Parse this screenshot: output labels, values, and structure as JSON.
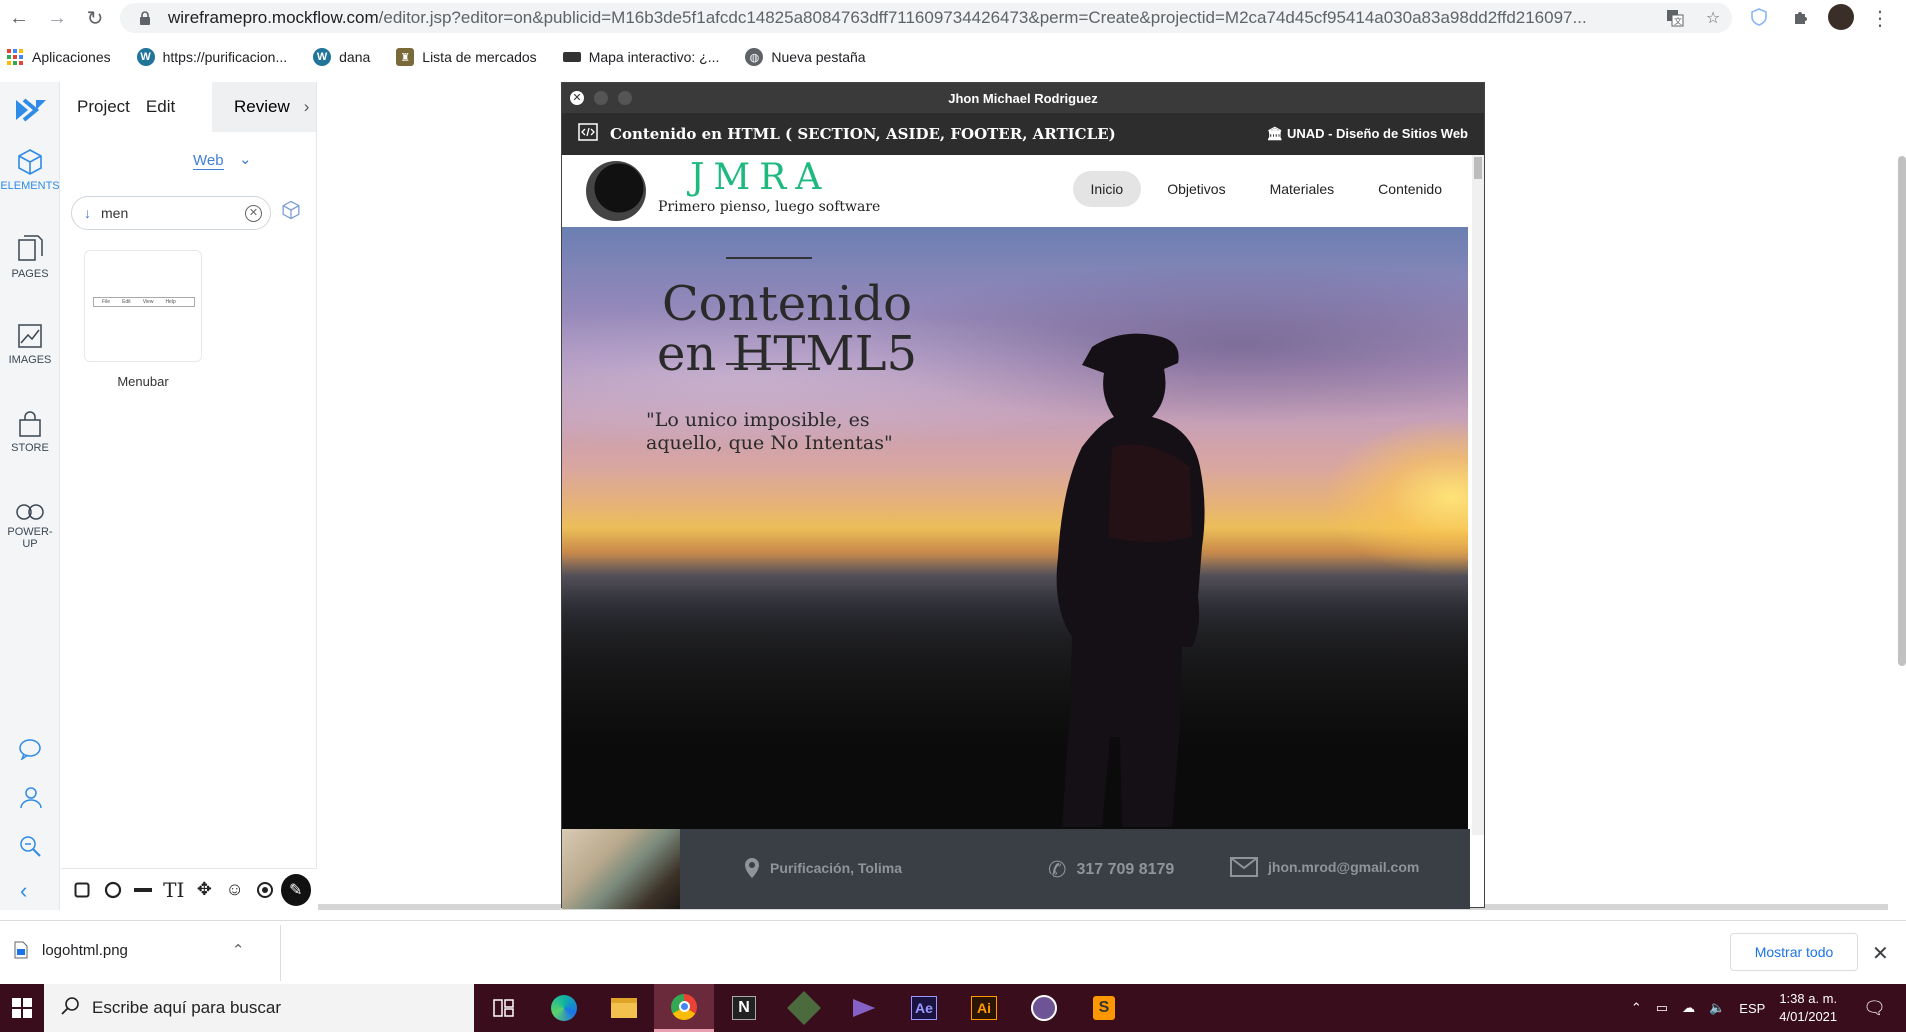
{
  "browser": {
    "url_host": "wireframepro.mockflow.com",
    "url_rest": "/editor.jsp?editor=on&publicid=M16b3de5f1afcdc14825a8084763dff711609734426473&perm=Create&projectid=M2ca74d45cf95414a030a83a98dd2ffd216097...",
    "bookmarks": [
      {
        "label": "Aplicaciones",
        "icon": "apps-grid-icon",
        "color": "#e34234"
      },
      {
        "label": "https://purificacion...",
        "icon": "wordpress-icon",
        "color": "#21759b"
      },
      {
        "label": "dana",
        "icon": "wordpress-icon",
        "color": "#21759b"
      },
      {
        "label": "Lista de mercados",
        "icon": "shield-crest-icon",
        "color": "#7a6a3a"
      },
      {
        "label": "Mapa interactivo: ¿...",
        "icon": "map-icon",
        "color": "#333333"
      },
      {
        "label": "Nueva pestaña",
        "icon": "globe-icon",
        "color": "#5f6368"
      }
    ]
  },
  "mockflow": {
    "rail": [
      {
        "label": "ELEMENTS",
        "icon": "cube-icon",
        "active": true
      },
      {
        "label": "PAGES",
        "icon": "pages-icon"
      },
      {
        "label": "IMAGES",
        "icon": "image-icon"
      },
      {
        "label": "STORE",
        "icon": "bag-icon"
      },
      {
        "label": "POWER-UP",
        "icon": "infinity-icon"
      }
    ],
    "menu": {
      "project": "Project",
      "edit": "Edit",
      "review": "Review"
    },
    "platform": "Web",
    "search_value": "men",
    "result_card_label": "Menubar",
    "thumb_menu": [
      "File",
      "Edit",
      "View",
      "Help"
    ],
    "accent": "#3f7fd6"
  },
  "mockup": {
    "window_title": "Jhon Michael Rodriguez",
    "subtitle": "Contenido en HTML ( SECTION, ASIDE, FOOTER, ARTICLE)",
    "subtitle_right": "UNAD - Diseño de Sitios Web",
    "brand": "JMRA",
    "tagline": "Primero pienso, luego software",
    "nav": [
      "Inicio",
      "Objetivos",
      "Materiales",
      "Contenido"
    ],
    "hero_title": "Contenido en HTML5",
    "hero_quote": "\"Lo unico imposible, es aquello, que No  Intentas\"",
    "footer": {
      "location": "Purificación, Tolima",
      "phone": "317 709 8179",
      "email": "jhon.mrod@gmail.com"
    },
    "brand_color": "#1db97f"
  },
  "downloads": {
    "file": "logohtml.png",
    "show_all": "Mostrar todo"
  },
  "taskbar": {
    "search_placeholder": "Escribe aquí para buscar",
    "apps": [
      "task-view",
      "edge",
      "file-explorer",
      "chrome",
      "notion",
      "sketchup",
      "vs",
      "after-effects",
      "illustrator",
      "github",
      "sublime"
    ],
    "language": "ESP",
    "time": "1:38 a. m.",
    "date": "4/01/2021"
  }
}
